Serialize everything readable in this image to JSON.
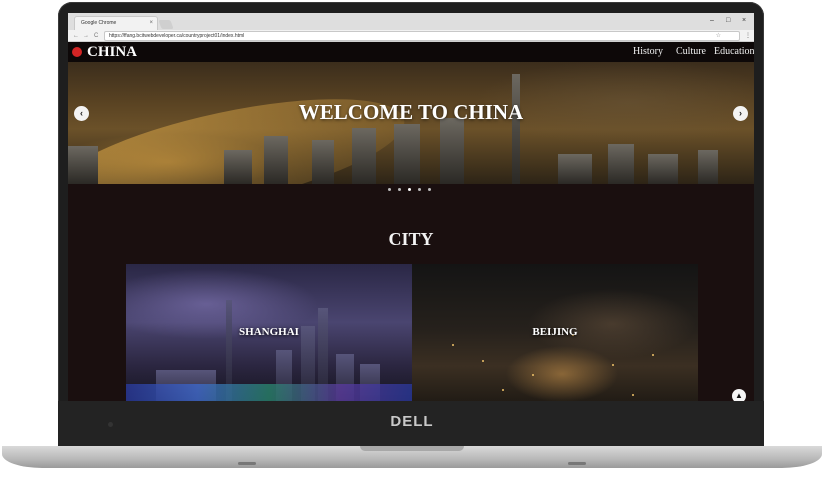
{
  "browser": {
    "tab_title": "Google Chrome",
    "tab_close": "×",
    "url": "https://ffang.bcitwebdeveloper.ca/countryproject01/index.html",
    "window_controls": [
      "–",
      "□",
      "×"
    ],
    "nav_glyphs": [
      "←",
      "→",
      "C"
    ],
    "star": "☆",
    "menu": "⋮"
  },
  "site": {
    "brand": "CHINA",
    "brand_color": "#d42525",
    "nav": [
      "History",
      "Culture",
      "Education"
    ],
    "hero_title": "WELCOME TO CHINA",
    "carousel": {
      "prev": "‹",
      "next": "›",
      "slide_count": 5
    },
    "section_heading": "CITY",
    "cities": [
      "SHANGHAI",
      "BEIJING"
    ],
    "scroll_top": "▲"
  },
  "device": {
    "brand": "DELL"
  }
}
